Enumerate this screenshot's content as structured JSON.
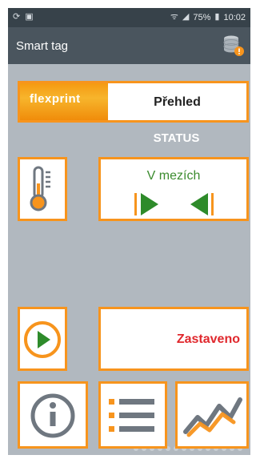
{
  "statusbar": {
    "battery_percent": "75%",
    "time": "10:02",
    "icons": [
      "sync-icon",
      "image-icon",
      "wifi-icon",
      "signal-icon",
      "battery-icon"
    ]
  },
  "appbar": {
    "title": "Smart tag",
    "icon": "database-alert-icon"
  },
  "header": {
    "logo_text": "flexprint",
    "title": "Přehled"
  },
  "status": {
    "label": "STATUS",
    "range_text": "V mezích",
    "run_state": "Zastaveno"
  },
  "colors": {
    "accent": "#f7941d",
    "background": "#b1b8bf",
    "appbar": "#4a555e",
    "ok_green": "#3c8c2f",
    "stopped_red": "#e0282d"
  }
}
